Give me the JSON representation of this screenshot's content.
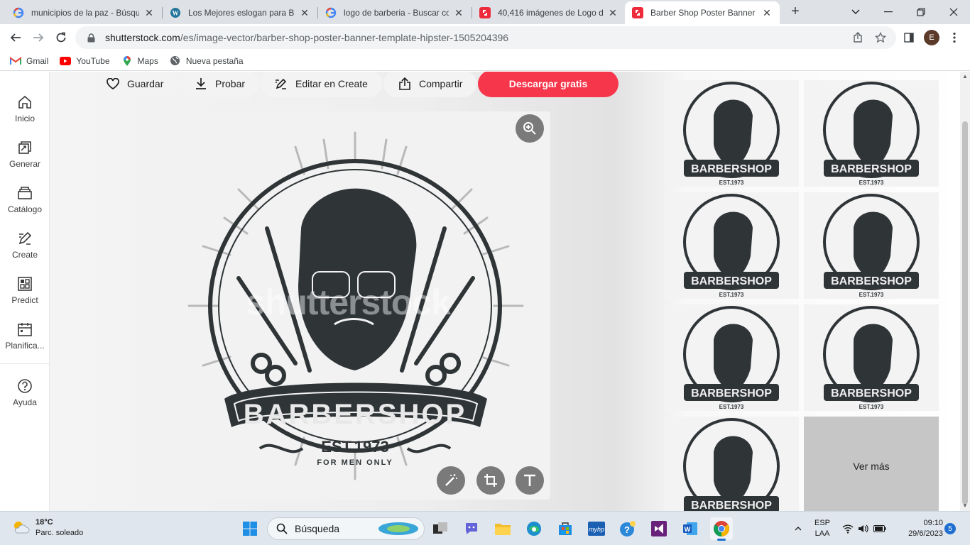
{
  "browser": {
    "tabs": [
      {
        "title": "municipios de la paz - Búsque",
        "favicon": "google-icon"
      },
      {
        "title": "Los Mejores eslogan para Bar",
        "favicon": "wordpress-icon"
      },
      {
        "title": "logo de barberia - Buscar con",
        "favicon": "google-icon"
      },
      {
        "title": "40,416 imágenes de Logo de",
        "favicon": "shutterstock-icon"
      },
      {
        "title": "Barber Shop Poster Banner Te",
        "favicon": "shutterstock-icon",
        "active": true
      }
    ],
    "url_host": "shutterstock.com",
    "url_path": "/es/image-vector/barber-shop-poster-banner-template-hipster-1505204396",
    "profile_initial": "E",
    "bookmarks": [
      {
        "label": "Gmail",
        "icon": "gmail-icon"
      },
      {
        "label": "YouTube",
        "icon": "youtube-icon"
      },
      {
        "label": "Maps",
        "icon": "maps-icon"
      },
      {
        "label": "Nueva pestaña",
        "icon": "globe-icon"
      }
    ]
  },
  "sidebar": {
    "items": [
      {
        "label": "Inicio",
        "icon": "home-icon"
      },
      {
        "label": "Generar",
        "icon": "generate-icon"
      },
      {
        "label": "Catálogo",
        "icon": "catalog-icon"
      },
      {
        "label": "Create",
        "icon": "create-icon"
      },
      {
        "label": "Predict",
        "icon": "predict-icon"
      },
      {
        "label": "Planifica...",
        "icon": "calendar-icon"
      },
      {
        "label": "Ayuda",
        "icon": "help-icon"
      }
    ]
  },
  "actions": {
    "save": "Guardar",
    "try": "Probar",
    "edit": "Editar en Create",
    "share": "Compartir",
    "download": "Descargar gratis"
  },
  "preview": {
    "watermark": "shutterstock",
    "logo_main": "BARBERSHOP",
    "logo_est": "EST.1973",
    "logo_tagline": "FOR MEN ONLY"
  },
  "related": {
    "thumb_label": "BARBERSHOP",
    "thumb_est": "EST.1973",
    "see_more": "Ver más"
  },
  "taskbar": {
    "temperature": "18°C",
    "weather": "Parc. soleado",
    "search": "Búsqueda",
    "lang_top": "ESP",
    "lang_bottom": "LAA",
    "time": "09:10",
    "date": "29/6/2023",
    "notifications": "5"
  },
  "colors": {
    "accent": "#f6364b",
    "logo_dark": "#2f3437"
  }
}
